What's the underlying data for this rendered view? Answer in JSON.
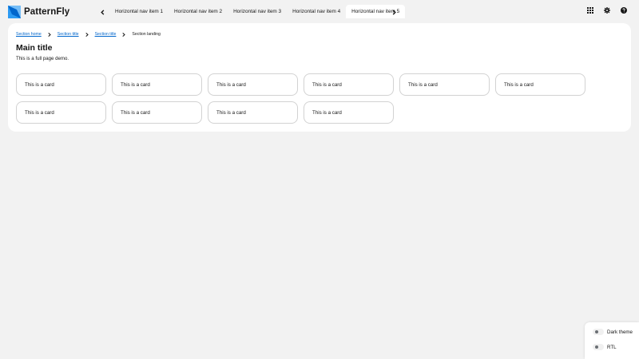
{
  "brand": {
    "name": "PatternFly"
  },
  "nav": {
    "items": [
      {
        "label": "Horizontal nav item 1"
      },
      {
        "label": "Horizontal nav item 2"
      },
      {
        "label": "Horizontal nav item 3"
      },
      {
        "label": "Horizontal nav item 4"
      },
      {
        "label": "Horizontal nav item 5",
        "current": true
      }
    ]
  },
  "tools": [
    "apps-grid-icon",
    "gear-icon",
    "help-icon"
  ],
  "breadcrumb": {
    "items": [
      {
        "label": "Section home"
      },
      {
        "label": "Section title"
      },
      {
        "label": "Section title"
      },
      {
        "label": "Section landing"
      }
    ]
  },
  "page": {
    "title": "Main title",
    "description": "This is a full page demo."
  },
  "cards": [
    {
      "label": "This is a card"
    },
    {
      "label": "This is a card"
    },
    {
      "label": "This is a card"
    },
    {
      "label": "This is a card"
    },
    {
      "label": "This is a card"
    },
    {
      "label": "This is a card"
    },
    {
      "label": "This is a card"
    },
    {
      "label": "This is a card"
    },
    {
      "label": "This is a card"
    },
    {
      "label": "This is a card"
    }
  ],
  "theme_panel": {
    "dark_theme_label": "Dark theme",
    "rtl_label": "RTL"
  },
  "colors": {
    "link": "#0066cc",
    "background": "#f2f2f2",
    "surface": "#ffffff",
    "logo_light": "#7fc0f5",
    "logo_dark": "#0066cc"
  }
}
